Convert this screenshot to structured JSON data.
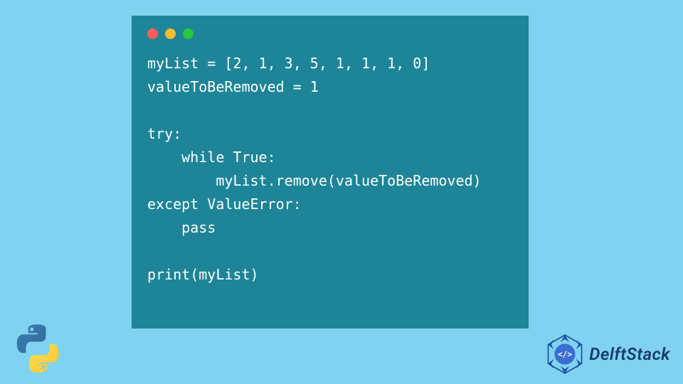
{
  "code": {
    "lines": [
      "myList = [2, 1, 3, 5, 1, 1, 1, 0]",
      "valueToBeRemoved = 1",
      "",
      "try:",
      "    while True:",
      "        myList.remove(valueToBeRemoved)",
      "except ValueError:",
      "    pass",
      "",
      "print(myList)"
    ]
  },
  "branding": {
    "site_name": "DelftStack"
  },
  "window": {
    "dot_colors": {
      "red": "#ff5f57",
      "yellow": "#febc2e",
      "green": "#28c840"
    }
  }
}
